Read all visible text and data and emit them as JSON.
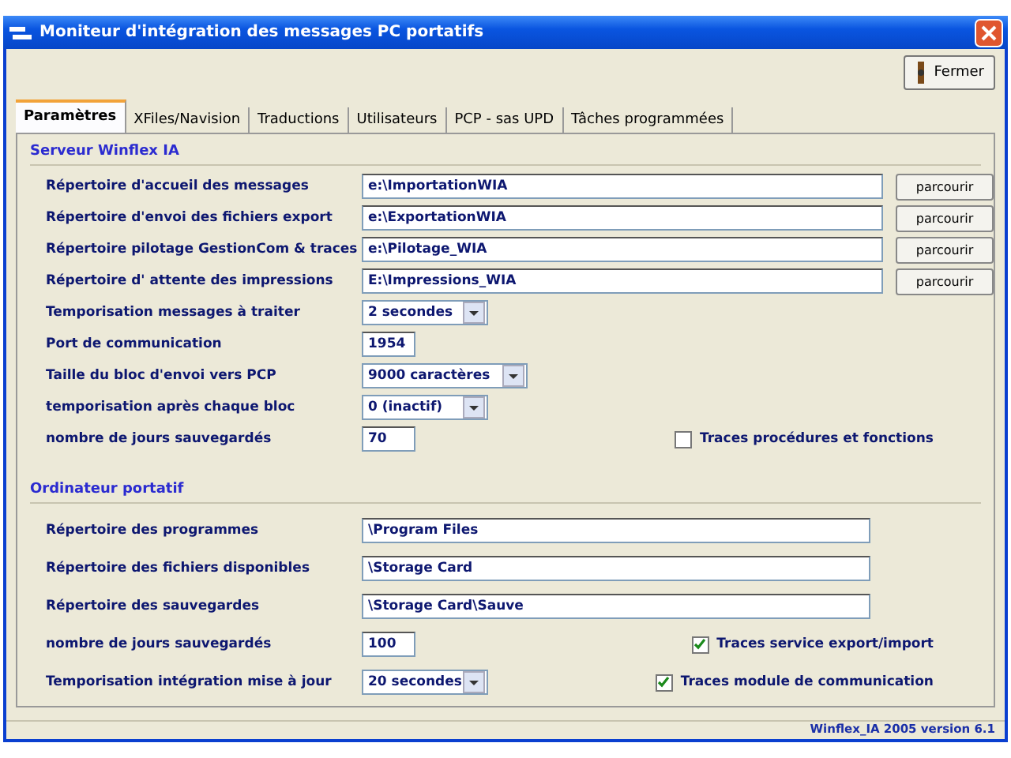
{
  "window": {
    "title": "Moniteur d'intégration des messages PC portatifs"
  },
  "close_button": {
    "label": "Fermer"
  },
  "tabs": [
    {
      "label": "Paramètres",
      "selected": true
    },
    {
      "label": "XFiles/Navision",
      "selected": false
    },
    {
      "label": "Traductions",
      "selected": false
    },
    {
      "label": "Utilisateurs",
      "selected": false
    },
    {
      "label": "PCP - sas UPD",
      "selected": false
    },
    {
      "label": "Tâches programmées",
      "selected": false
    }
  ],
  "sections": [
    {
      "title": "Serveur Winflex IA",
      "fields": [
        {
          "kind": "path",
          "label": "Répertoire d'accueil des messages",
          "value": "e:\\ImportationWIA",
          "button": "parcourir"
        },
        {
          "kind": "path",
          "label": "Répertoire d'envoi des fichiers export",
          "value": "e:\\ExportationWIA",
          "button": "parcourir"
        },
        {
          "kind": "path",
          "label": "Répertoire pilotage GestionCom & traces",
          "value": "e:\\Pilotage_WIA",
          "button": "parcourir"
        },
        {
          "kind": "path",
          "label": "Répertoire d' attente des impressions",
          "value": "E:\\Impressions_WIA",
          "button": "parcourir"
        },
        {
          "kind": "select",
          "label": "Temporisation messages à traiter",
          "value": "2 secondes"
        },
        {
          "kind": "number",
          "label": "Port de communication",
          "value": "1954"
        },
        {
          "kind": "select-wide",
          "label": "Taille du bloc  d'envoi vers PCP",
          "value": "9000 caractères"
        },
        {
          "kind": "select",
          "label": "temporisation après chaque bloc",
          "value": "0 (inactif)"
        },
        {
          "kind": "number",
          "label": "nombre de jours sauvegardés",
          "value": "70",
          "checkbox": {
            "label": "Traces procédures et fonctions",
            "checked": false
          }
        }
      ]
    },
    {
      "title": "Ordinateur portatif",
      "fields": [
        {
          "kind": "path",
          "label": "Répertoire des programmes",
          "value": "\\Program Files"
        },
        {
          "kind": "path",
          "label": "Répertoire des fichiers disponibles",
          "value": "\\Storage Card"
        },
        {
          "kind": "path",
          "label": "Répertoire des sauvegardes",
          "value": "\\Storage Card\\Sauve"
        },
        {
          "kind": "number",
          "label": "nombre de jours sauvegardés",
          "value": "100",
          "checkbox": {
            "label": "Traces service export/import",
            "checked": true
          }
        },
        {
          "kind": "select",
          "label": "Temporisation intégration mise à jour",
          "value": "20 secondes",
          "checkbox": {
            "label": "Traces module de communication",
            "checked": true
          }
        }
      ]
    }
  ],
  "status_bar": {
    "text": "Winflex_IA 2005 version 6.1"
  }
}
